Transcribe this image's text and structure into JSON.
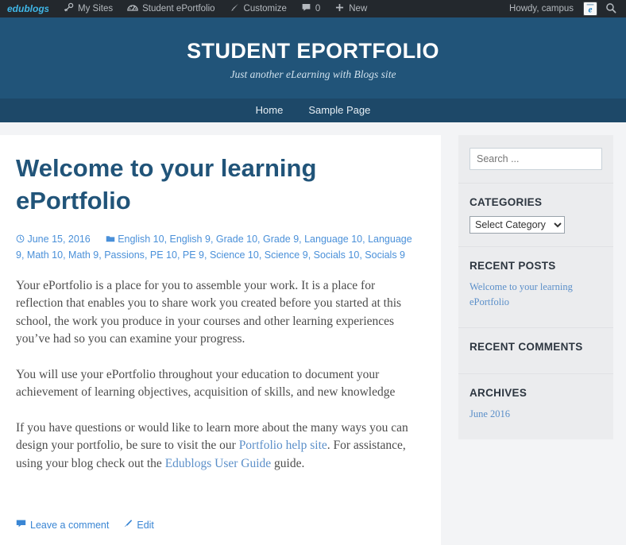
{
  "adminbar": {
    "logo": "edublogs-logo",
    "items": [
      {
        "label": "My Sites",
        "icon": "key-icon"
      },
      {
        "label": "Student ePortfolio",
        "icon": "dashboard-icon"
      },
      {
        "label": "Customize",
        "icon": "paintbrush-icon"
      },
      {
        "label": "0",
        "icon": "comment-icon"
      },
      {
        "label": "New",
        "icon": "plus-icon"
      }
    ],
    "howdy": "Howdy, campus",
    "avatar": "avatar-icon",
    "search": "search-icon"
  },
  "header": {
    "title": "STUDENT EPORTFOLIO",
    "tagline": "Just another eLearning with Blogs site",
    "bg_color": "#215479"
  },
  "nav": {
    "items": [
      {
        "label": "Home"
      },
      {
        "label": "Sample Page"
      }
    ],
    "bg_color": "#1d4868"
  },
  "post": {
    "title": "Welcome to your learning ePortfolio",
    "date": "June 15, 2016",
    "date_icon": "clock-icon",
    "category_icon": "folder-icon",
    "categories": [
      "English 10",
      "English 9",
      "Grade 10",
      "Grade 9",
      "Language 10",
      "Language 9",
      "Math 10",
      "Math 9",
      "Passions",
      "PE 10",
      "PE 9",
      "Science 10",
      "Science 9",
      "Socials 10",
      "Socials 9"
    ],
    "paragraphs": [
      "Your ePortfolio is a place for you to assemble your work.  It is a place for reflection that enables you to share work you created before you started at this school, the work you produce in your courses and other learning experiences you’ve had so you can examine your progress.",
      "You will use your ePortfolio throughout your education to document your achievement of learning objectives, acquisition of skills, and new knowledge"
    ],
    "paragraph3": {
      "before_link1": "If you have questions or would like to learn more about the many ways you can design your portfolio, be sure to visit the our ",
      "link1": "Portfolio help site",
      "between_links": ".  For assistance, using your blog check out the ",
      "link2": "Edublogs User Guide",
      "after_link2": " guide."
    },
    "footer": {
      "comment_label": "Leave a comment",
      "comment_icon": "comment-bubble-icon",
      "edit_label": "Edit",
      "edit_icon": "pencil-icon"
    },
    "title_color": "#215479"
  },
  "sidebar": {
    "search": {
      "placeholder": "Search ...",
      "value": ""
    },
    "categories": {
      "title": "CATEGORIES",
      "selected": "Select Category"
    },
    "recent_posts": {
      "title": "RECENT POSTS",
      "items": [
        "Welcome to your learning ePortfolio"
      ]
    },
    "recent_comments": {
      "title": "RECENT COMMENTS",
      "items": []
    },
    "archives": {
      "title": "ARCHIVES",
      "items": [
        "June 2016"
      ]
    }
  }
}
